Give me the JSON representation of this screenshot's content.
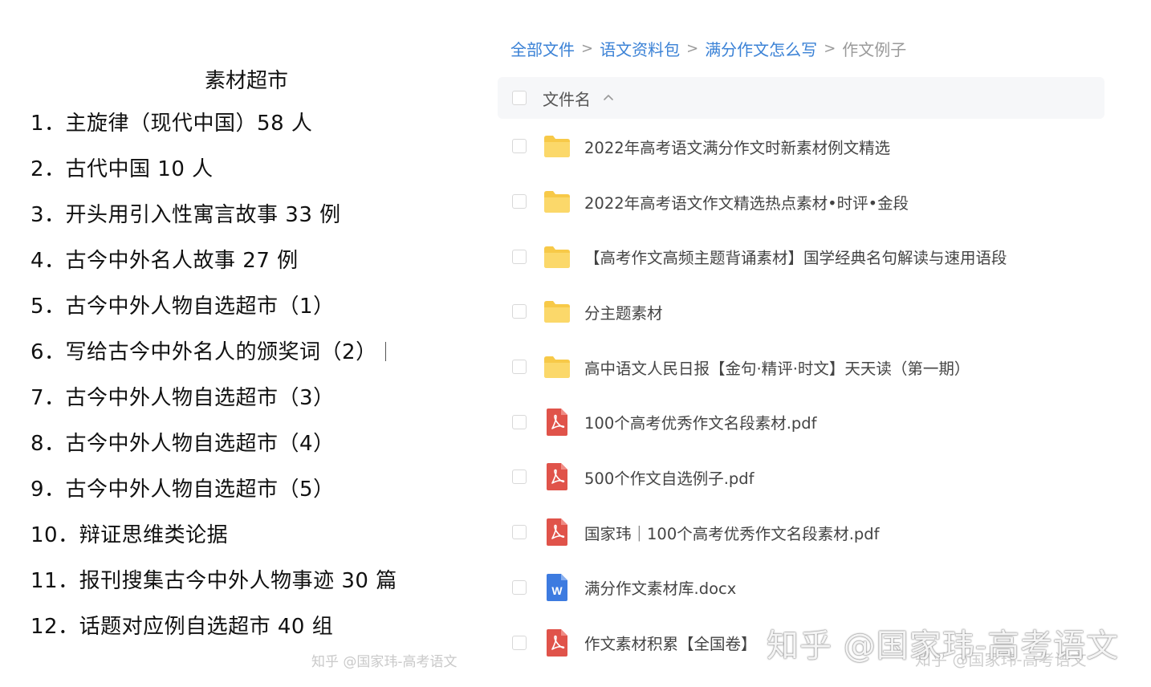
{
  "left": {
    "title": "素材超市",
    "items": [
      "1．主旋律（现代中国）58 人",
      "2．古代中国 10 人",
      "3．开头用引入性寓言故事 33 例",
      "4．古今中外名人故事 27 例",
      "5．古今中外人物自选超市（1）",
      "6．写给古今中外名人的颁奖词（2）",
      "7．古今中外人物自选超市（3）",
      "8．古今中外人物自选超市（4）",
      "9．古今中外人物自选超市（5）",
      "10．辩证思维类论据",
      "11．报刊搜集古今中外人物事迹 30 篇",
      "12．话题对应例自选超市 40 组"
    ],
    "watermark": "知乎 @国家玮-高考语文"
  },
  "breadcrumb": {
    "items": [
      "全部文件",
      "语文资料包",
      "满分作文怎么写"
    ],
    "current": "作文例子",
    "separator": ">"
  },
  "header": {
    "column_label": "文件名"
  },
  "files": [
    {
      "name": "2022年高考语文满分作文时新素材例文精选",
      "type": "folder"
    },
    {
      "name": "2022年高考语文作文精选热点素材•时评•金段",
      "type": "folder"
    },
    {
      "name": "【高考作文高频主题背诵素材】国学经典名句解读与速用语段",
      "type": "folder"
    },
    {
      "name": "分主题素材",
      "type": "folder"
    },
    {
      "name": "高中语文人民日报【金句·精评·时文】天天读（第一期）",
      "type": "folder"
    },
    {
      "name": "100个高考优秀作文名段素材.pdf",
      "type": "pdf"
    },
    {
      "name": "500个作文自选例子.pdf",
      "type": "pdf"
    },
    {
      "name": "国家玮｜100个高考优秀作文名段素材.pdf",
      "type": "pdf"
    },
    {
      "name": "满分作文素材库.docx",
      "type": "word"
    },
    {
      "name": "作文素材积累【全国卷】",
      "type": "pdf"
    }
  ],
  "overlay": {
    "big_watermark": "知乎 @国家玮-高考语文",
    "small_watermark": "知乎 @国家玮-高考语文"
  },
  "colors": {
    "link": "#3b82d6",
    "folder": "#f7c948",
    "pdf": "#e0534a",
    "word": "#3d7be0"
  }
}
